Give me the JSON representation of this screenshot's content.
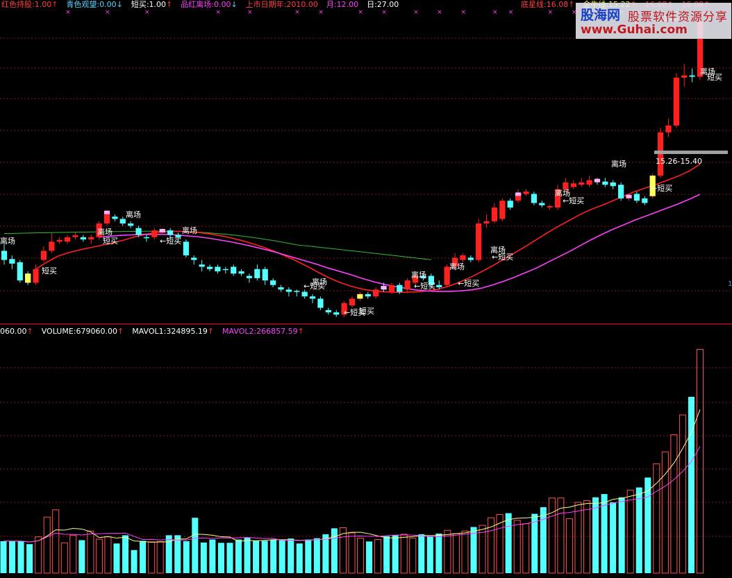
{
  "header": {
    "items": [
      {
        "label": "红色持股:",
        "value": "1.00",
        "arrow": "↑",
        "color": "#ff4040",
        "arrow_color": "#ff3030"
      },
      {
        "label": "青色观望:",
        "value": "0.00",
        "arrow": "↓",
        "color": "#5ad7ff",
        "arrow_color": "#5ad7ff"
      },
      {
        "label": "短买:",
        "value": "1.00",
        "arrow": "↑",
        "color": "#ffffff",
        "arrow_color": "#ff3030"
      },
      {
        "label": "品红离场:",
        "value": "0.00",
        "arrow": "↓",
        "color": "#ff40ff",
        "arrow_color": "#5ad7ff"
      },
      {
        "label": "上市日期年:",
        "value": "2010.00",
        "arrow": "",
        "color": "#ff4040",
        "arrow_color": "#ff3030"
      },
      {
        "label": "月:",
        "value": "12.00",
        "arrow": "",
        "color": "#ff40ff",
        "arrow_color": "#ff3030"
      },
      {
        "label": "日:",
        "value": "27.00",
        "arrow": "",
        "color": "#ffffff",
        "arrow_color": "#ff3030"
      }
    ],
    "extra": [
      {
        "label": "底星线:",
        "value": "16.08",
        "arrow": "↑",
        "color": "#ff4040"
      },
      {
        "label": "金牛线:",
        "value": "15.22",
        "arrow": "↑",
        "color": "#ffff40"
      },
      {
        "label": "",
        "value": "16.08",
        "arrow": "↑",
        "color": "#ff4040"
      },
      {
        "label": "",
        "value": "16.08",
        "arrow": "↑",
        "color": "#ff4040"
      }
    ]
  },
  "volume_header": [
    {
      "label": "",
      "value": "060.00",
      "arrow": "↑",
      "color": "#ffffff"
    },
    {
      "label": "VOLUME:",
      "value": "679060.00",
      "arrow": "↑",
      "color": "#ffffff"
    },
    {
      "label": "MAVOL1:",
      "value": "324895.19",
      "arrow": "↑",
      "color": "#ffffff"
    },
    {
      "label": "MAVOL2:",
      "value": "266857.59",
      "arrow": "↑",
      "color": "#ff40ff"
    }
  ],
  "watermark": {
    "logo": "股海网",
    "slogan": "股票软件资源分享",
    "url": "www.Guhai.com"
  },
  "annotations": {
    "high_price": "19.63",
    "range_label": "15.26-15.40",
    "signal_exit": "离场",
    "signal_buy": "短买",
    "arrow_buy": "←短买"
  },
  "colors": {
    "up": "#ff2020",
    "down": "#54ffff",
    "ma_red": "#ff2020",
    "ma_magenta": "#ff40ff",
    "ma_green": "#30c030",
    "mavol1": "#ffff80",
    "mavol2": "#ff40ff",
    "grid": "#8a1818",
    "divider": "#b01010"
  },
  "chart_data": [
    {
      "type": "candlestick",
      "title": "",
      "note": "price pane; values in price units read from the candle positions",
      "candles": [
        {
          "o": 14.6,
          "c": 14.4,
          "h": 14.75,
          "l": 14.3
        },
        {
          "o": 14.42,
          "c": 14.32,
          "h": 14.5,
          "l": 14.2
        },
        {
          "o": 14.35,
          "c": 13.95,
          "h": 14.4,
          "l": 13.9
        },
        {
          "o": 14.1,
          "c": 13.9,
          "h": 14.15,
          "l": 13.85
        },
        {
          "o": 13.9,
          "c": 14.2,
          "h": 14.3,
          "l": 13.85
        },
        {
          "o": 14.4,
          "c": 14.6,
          "h": 14.7,
          "l": 14.35
        },
        {
          "o": 14.6,
          "c": 14.8,
          "h": 15.0,
          "l": 14.55
        },
        {
          "o": 14.8,
          "c": 14.84,
          "h": 14.9,
          "l": 14.75
        },
        {
          "o": 14.8,
          "c": 14.9,
          "h": 14.95,
          "l": 14.75
        },
        {
          "o": 14.9,
          "c": 14.94,
          "h": 15.0,
          "l": 14.85
        },
        {
          "o": 14.9,
          "c": 14.85,
          "h": 14.95,
          "l": 14.8
        },
        {
          "o": 14.85,
          "c": 14.9,
          "h": 14.95,
          "l": 14.75
        },
        {
          "o": 14.9,
          "c": 15.2,
          "h": 15.25,
          "l": 14.85
        },
        {
          "o": 15.2,
          "c": 15.45,
          "h": 15.5,
          "l": 15.15
        },
        {
          "o": 15.35,
          "c": 15.3,
          "h": 15.4,
          "l": 15.25
        },
        {
          "o": 15.3,
          "c": 15.2,
          "h": 15.35,
          "l": 15.15
        },
        {
          "o": 15.2,
          "c": 15.15,
          "h": 15.25,
          "l": 15.1
        },
        {
          "o": 15.1,
          "c": 14.95,
          "h": 15.15,
          "l": 14.9
        },
        {
          "o": 14.9,
          "c": 14.88,
          "h": 14.95,
          "l": 14.8
        },
        {
          "o": 14.9,
          "c": 15.05,
          "h": 15.1,
          "l": 14.85
        },
        {
          "o": 15.0,
          "c": 15.05,
          "h": 15.1,
          "l": 14.95
        },
        {
          "o": 15.05,
          "c": 14.95,
          "h": 15.1,
          "l": 14.85
        },
        {
          "o": 14.95,
          "c": 14.9,
          "h": 15.0,
          "l": 14.8
        },
        {
          "o": 14.8,
          "c": 14.5,
          "h": 14.85,
          "l": 14.45
        },
        {
          "o": 14.45,
          "c": 14.4,
          "h": 14.5,
          "l": 14.3
        },
        {
          "o": 14.3,
          "c": 14.25,
          "h": 14.4,
          "l": 14.15
        },
        {
          "o": 14.25,
          "c": 14.2,
          "h": 14.3,
          "l": 14.15
        },
        {
          "o": 14.25,
          "c": 14.15,
          "h": 14.3,
          "l": 14.1
        },
        {
          "o": 14.2,
          "c": 14.18,
          "h": 14.25,
          "l": 14.1
        },
        {
          "o": 14.25,
          "c": 14.1,
          "h": 14.3,
          "l": 14.05
        },
        {
          "o": 14.15,
          "c": 14.1,
          "h": 14.2,
          "l": 14.05
        },
        {
          "o": 14.05,
          "c": 14.0,
          "h": 14.1,
          "l": 13.9
        },
        {
          "o": 14.2,
          "c": 14.0,
          "h": 14.3,
          "l": 13.95
        },
        {
          "o": 14.2,
          "c": 13.95,
          "h": 14.25,
          "l": 13.85
        },
        {
          "o": 13.95,
          "c": 13.85,
          "h": 14.0,
          "l": 13.8
        },
        {
          "o": 13.8,
          "c": 13.75,
          "h": 13.85,
          "l": 13.7
        },
        {
          "o": 13.75,
          "c": 13.7,
          "h": 13.8,
          "l": 13.6
        },
        {
          "o": 13.72,
          "c": 13.7,
          "h": 13.75,
          "l": 13.6
        },
        {
          "o": 13.7,
          "c": 13.6,
          "h": 13.75,
          "l": 13.55
        },
        {
          "o": 13.6,
          "c": 13.55,
          "h": 13.65,
          "l": 13.45
        },
        {
          "o": 13.55,
          "c": 13.35,
          "h": 13.6,
          "l": 13.3
        },
        {
          "o": 13.3,
          "c": 13.25,
          "h": 13.35,
          "l": 13.2
        },
        {
          "o": 13.25,
          "c": 13.2,
          "h": 13.3,
          "l": 13.15
        },
        {
          "o": 13.2,
          "c": 13.45,
          "h": 13.5,
          "l": 13.15
        },
        {
          "o": 13.4,
          "c": 13.55,
          "h": 13.6,
          "l": 13.35
        },
        {
          "o": 13.55,
          "c": 13.65,
          "h": 13.7,
          "l": 13.5
        },
        {
          "o": 13.65,
          "c": 13.6,
          "h": 13.7,
          "l": 13.55
        },
        {
          "o": 13.6,
          "c": 13.75,
          "h": 13.8,
          "l": 13.55
        },
        {
          "o": 13.8,
          "c": 13.75,
          "h": 13.9,
          "l": 13.7
        },
        {
          "o": 13.7,
          "c": 13.85,
          "h": 13.9,
          "l": 13.65
        },
        {
          "o": 13.85,
          "c": 13.7,
          "h": 13.9,
          "l": 13.65
        },
        {
          "o": 13.75,
          "c": 13.95,
          "h": 14.0,
          "l": 13.7
        },
        {
          "o": 13.9,
          "c": 14.05,
          "h": 14.1,
          "l": 13.85
        },
        {
          "o": 14.05,
          "c": 14.0,
          "h": 14.1,
          "l": 13.95
        },
        {
          "o": 14.05,
          "c": 13.85,
          "h": 14.1,
          "l": 13.8
        },
        {
          "o": 13.85,
          "c": 13.8,
          "h": 13.95,
          "l": 13.75
        },
        {
          "o": 13.85,
          "c": 14.25,
          "h": 14.3,
          "l": 13.8
        },
        {
          "o": 14.25,
          "c": 14.45,
          "h": 14.55,
          "l": 14.2
        },
        {
          "o": 14.4,
          "c": 14.5,
          "h": 14.55,
          "l": 14.35
        },
        {
          "o": 14.45,
          "c": 14.4,
          "h": 14.5,
          "l": 14.35
        },
        {
          "o": 14.4,
          "c": 15.2,
          "h": 15.3,
          "l": 14.35
        },
        {
          "o": 15.2,
          "c": 15.25,
          "h": 15.4,
          "l": 15.1
        },
        {
          "o": 15.25,
          "c": 15.55,
          "h": 15.65,
          "l": 15.2
        },
        {
          "o": 15.3,
          "c": 15.7,
          "h": 15.75,
          "l": 15.25
        },
        {
          "o": 15.7,
          "c": 15.55,
          "h": 15.75,
          "l": 15.5
        },
        {
          "o": 15.7,
          "c": 15.85,
          "h": 15.95,
          "l": 15.65
        },
        {
          "o": 15.85,
          "c": 15.9,
          "h": 15.95,
          "l": 15.8
        },
        {
          "o": 15.85,
          "c": 15.65,
          "h": 15.9,
          "l": 15.6
        },
        {
          "o": 15.65,
          "c": 15.6,
          "h": 15.7,
          "l": 15.55
        },
        {
          "o": 15.55,
          "c": 15.58,
          "h": 15.62,
          "l": 15.5
        },
        {
          "o": 15.55,
          "c": 15.95,
          "h": 16.05,
          "l": 15.5
        },
        {
          "o": 15.95,
          "c": 16.1,
          "h": 16.2,
          "l": 15.9
        },
        {
          "o": 16.0,
          "c": 16.08,
          "h": 16.15,
          "l": 15.95
        },
        {
          "o": 16.05,
          "c": 16.1,
          "h": 16.2,
          "l": 16.0
        },
        {
          "o": 16.05,
          "c": 16.15,
          "h": 16.25,
          "l": 16.0
        },
        {
          "o": 16.15,
          "c": 16.12,
          "h": 16.2,
          "l": 16.05
        },
        {
          "o": 16.12,
          "c": 16.05,
          "h": 16.2,
          "l": 16.0
        },
        {
          "o": 16.1,
          "c": 16.02,
          "h": 16.15,
          "l": 15.95
        },
        {
          "o": 16.05,
          "c": 15.75,
          "h": 16.1,
          "l": 15.7
        },
        {
          "o": 15.75,
          "c": 15.8,
          "h": 15.85,
          "l": 15.7
        },
        {
          "o": 15.85,
          "c": 15.7,
          "h": 15.9,
          "l": 15.65
        },
        {
          "o": 15.75,
          "c": 15.65,
          "h": 15.8,
          "l": 15.6
        },
        {
          "o": 15.8,
          "c": 16.25,
          "h": 16.3,
          "l": 15.75
        },
        {
          "o": 16.25,
          "c": 17.2,
          "h": 17.3,
          "l": 16.2
        },
        {
          "o": 17.2,
          "c": 17.35,
          "h": 17.5,
          "l": 17.1
        },
        {
          "o": 17.35,
          "c": 18.4,
          "h": 18.5,
          "l": 17.3
        },
        {
          "o": 18.4,
          "c": 18.45,
          "h": 18.7,
          "l": 18.2
        },
        {
          "o": 18.45,
          "c": 18.42,
          "h": 18.6,
          "l": 18.3
        },
        {
          "o": 18.42,
          "c": 19.63,
          "h": 19.63,
          "l": 18.35
        }
      ],
      "ma_red": [
        14.2,
        14.35,
        14.48,
        14.56,
        14.62,
        14.67,
        14.72,
        14.77,
        14.83,
        14.9,
        14.96,
        15.0,
        15.02,
        15.03,
        15.02,
        15.0,
        14.97,
        14.93,
        14.88,
        14.82,
        14.75,
        14.67,
        14.58,
        14.48,
        14.37,
        14.25,
        14.12,
        14.0,
        13.9,
        13.82,
        13.76,
        13.72,
        13.7,
        13.69,
        13.69,
        13.7,
        13.72,
        13.76,
        13.83,
        13.92,
        14.03,
        14.15,
        14.28,
        14.42,
        14.56,
        14.7,
        14.85,
        15.0,
        15.14,
        15.27,
        15.4,
        15.51,
        15.6,
        15.7,
        15.8,
        15.9,
        15.98,
        16.06,
        16.15,
        16.24,
        16.35,
        16.5
      ],
      "ma_magenta": [
        14.9,
        14.92,
        14.94,
        14.95,
        14.96,
        14.96,
        14.96,
        14.95,
        14.93,
        14.91,
        14.88,
        14.84,
        14.8,
        14.75,
        14.7,
        14.64,
        14.58,
        14.51,
        14.44,
        14.37,
        14.3,
        14.22,
        14.15,
        14.08,
        14.0,
        13.93,
        13.87,
        13.82,
        13.78,
        13.74,
        13.72,
        13.71,
        13.71,
        13.72,
        13.74,
        13.78,
        13.85,
        13.93,
        14.02,
        14.12,
        14.22,
        14.34,
        14.46,
        14.58,
        14.71,
        14.84,
        14.96,
        15.07,
        15.17,
        15.27,
        15.36,
        15.45,
        15.54,
        15.63,
        15.73,
        15.84
      ]
    },
    {
      "type": "bar",
      "title": "",
      "note": "volume pane; values in shares (relative to VOLUME 679060)",
      "values": [
        97000,
        97000,
        97000,
        88000,
        110000,
        170000,
        192000,
        92000,
        115000,
        100000,
        128000,
        103000,
        110000,
        90000,
        115000,
        70000,
        98000,
        95000,
        96000,
        115000,
        115000,
        97000,
        168000,
        93000,
        102000,
        92000,
        92000,
        102000,
        108000,
        98000,
        98000,
        102000,
        102000,
        105000,
        90000,
        102000,
        106000,
        118000,
        136000,
        138000,
        122000,
        106000,
        96000,
        102000,
        112000,
        116000,
        118000,
        106000,
        118000,
        112000,
        120000,
        130000,
        120000,
        128000,
        140000,
        145000,
        168000,
        178000,
        182000,
        160000,
        150000,
        180000,
        200000,
        228000,
        228000,
        165000,
        215000,
        220000,
        230000,
        240000,
        215000,
        230000,
        252000,
        260000,
        290000,
        332000,
        368000,
        420000,
        480000,
        535000,
        679060
      ]
    }
  ]
}
